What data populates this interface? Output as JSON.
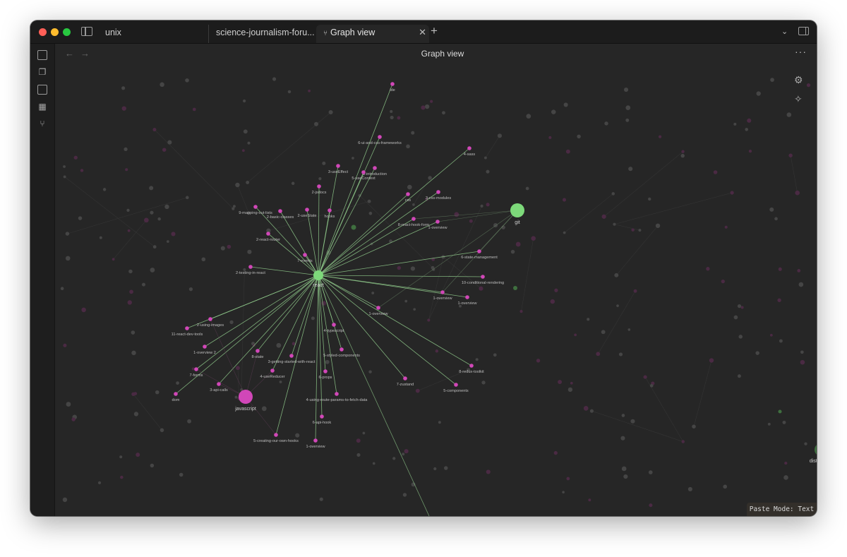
{
  "tabs": [
    {
      "label": "unix"
    },
    {
      "label": "science-journalism-foru..."
    },
    {
      "label": "Graph view",
      "active": true
    }
  ],
  "view_title": "Graph view",
  "status": {
    "paste_mode": "Paste Mode: Text"
  },
  "colors": {
    "bg": "#262626",
    "node_pink": "#d147b8",
    "node_green": "#7dd97a",
    "edge_highlight": "#8fc98a",
    "dim_node": "#555555"
  },
  "icons": {
    "ribbon": [
      "graph-switch-icon",
      "files-icon",
      "template-icon",
      "dashboard-icon",
      "graph-icon"
    ],
    "graph_controls": [
      "gear-icon",
      "magic-wand-icon"
    ]
  },
  "graph": {
    "hubs": [
      {
        "id": "react",
        "label": "react",
        "color": "green"
      },
      {
        "id": "git",
        "label": "git",
        "color": "green"
      },
      {
        "id": "javascript",
        "label": "javascript",
        "color": "pink"
      },
      {
        "id": "distributed",
        "label": "distributed",
        "color": "green"
      }
    ],
    "react_neighbors": [
      "ide",
      "6-ui-and-css-frameworks",
      "4-sass",
      "3-useEffect",
      "3-introduction",
      "5-useContext",
      "2-jsdocs",
      "css",
      "3-css-modules",
      "9-mapping-out-lists",
      "2-basic-classes",
      "2-useState",
      "hooks",
      "8-react-hook-form",
      "1-overview",
      "2-react-router",
      "6-state-management",
      "7-events",
      "2-testing-in-react",
      "10-conditional-rendering",
      "1-overview",
      "1-overview",
      "1-overview",
      "2-using-images",
      "11-react-dev-tools",
      "4-typescript",
      "1-overview 2",
      "5-styled-components",
      "8-state",
      "3-getting-started-with-react",
      "8-redux-toolkit",
      "7-forms",
      "4-useReducer",
      "6-props",
      "7-zustand",
      "3-api-calls",
      "5-components",
      "dom",
      "4-using-route-params-to-fetch-data",
      "6-api-hook",
      "5-creating-our-own-hooks",
      "1-overview"
    ]
  }
}
